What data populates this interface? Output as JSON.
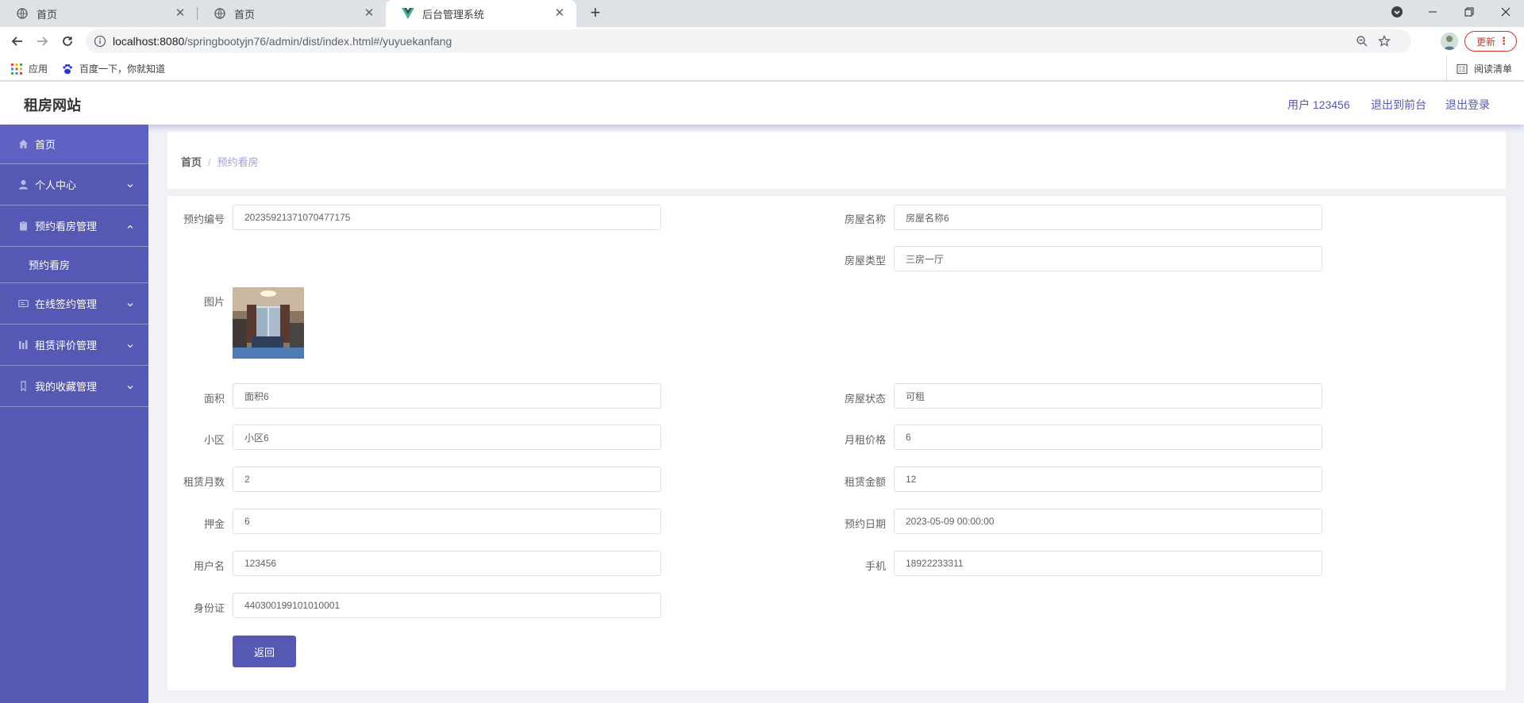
{
  "browser": {
    "tabs": [
      {
        "title": "首页",
        "icon": "globe-icon"
      },
      {
        "title": "首页",
        "icon": "globe-icon"
      },
      {
        "title": "后台管理系统",
        "icon": "vue-logo-icon"
      }
    ],
    "url_host": "localhost:8080",
    "url_path": "/springbootyjn76/admin/dist/index.html#/yuyuekanfang",
    "update_label": "更新",
    "bookmarks": [
      {
        "label": "应用",
        "icon": "apps-grid-icon"
      },
      {
        "label": "百度一下，你就知道",
        "icon": "baidu-paw-icon"
      }
    ],
    "reading_list": "阅读清单"
  },
  "header": {
    "site_title": "租房网站",
    "user_label": "用户 123456",
    "back_front": "退出到前台",
    "logout": "退出登录"
  },
  "sidebar": {
    "items": [
      {
        "label": "首页",
        "icon": "home-icon"
      },
      {
        "label": "个人中心",
        "icon": "user-icon",
        "expanded": false
      },
      {
        "label": "预约看房管理",
        "icon": "clipboard-icon",
        "expanded": true
      },
      {
        "label": "在线签约管理",
        "icon": "contract-icon",
        "expanded": false
      },
      {
        "label": "租赁评价管理",
        "icon": "chart-icon",
        "expanded": false
      },
      {
        "label": "我的收藏管理",
        "icon": "bookmark-icon",
        "expanded": false
      }
    ],
    "subitem": "预约看房"
  },
  "breadcrumb": {
    "home": "首页",
    "separator": "/",
    "current": "预约看房"
  },
  "form": {
    "order_no": {
      "label": "预约编号",
      "value": "20235921371070477175"
    },
    "house_name": {
      "label": "房屋名称",
      "value": "房屋名称6"
    },
    "house_type": {
      "label": "房屋类型",
      "value": "三房一厅"
    },
    "picture": {
      "label": "图片"
    },
    "area": {
      "label": "面积",
      "value": "面积6"
    },
    "house_status": {
      "label": "房屋状态",
      "value": "可租"
    },
    "community": {
      "label": "小区",
      "value": "小区6"
    },
    "monthly_rent": {
      "label": "月租价格",
      "value": "6"
    },
    "lease_months": {
      "label": "租赁月数",
      "value": "2"
    },
    "lease_amount": {
      "label": "租赁金额",
      "value": "12"
    },
    "deposit": {
      "label": "押金",
      "value": "6"
    },
    "booking_date": {
      "label": "预约日期",
      "value": "2023-05-09 00:00:00"
    },
    "username": {
      "label": "用户名",
      "value": "123456"
    },
    "phone": {
      "label": "手机",
      "value": "18922233311"
    },
    "id_card": {
      "label": "身份证",
      "value": "440300199101010001"
    },
    "back_button": "返回"
  },
  "colors": {
    "accent": "#5659b4",
    "breadcrumb_current": "#a0a3d8",
    "update_red": "#d93025"
  }
}
